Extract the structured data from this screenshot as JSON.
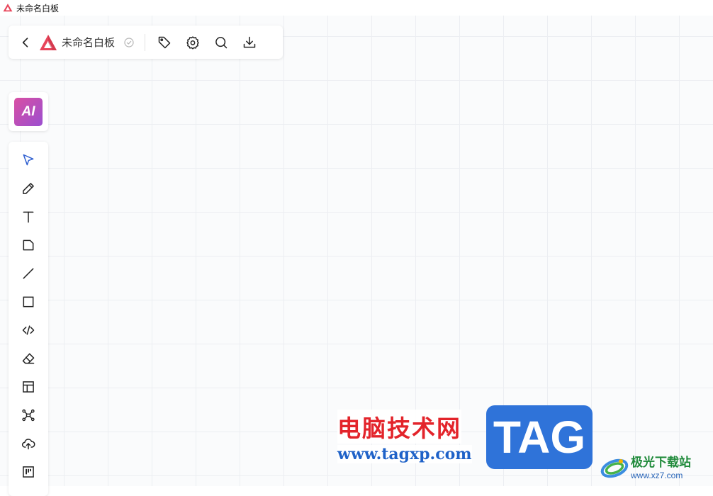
{
  "window": {
    "title": "未命名白板",
    "icons": {
      "app_logo": "red-triangle-logo-icon"
    }
  },
  "topbar": {
    "board_name": "未命名白板",
    "icons": {
      "back": "chevron-left-icon",
      "logo": "red-triangle-logo-icon",
      "saved": "check-circle-icon",
      "tag": "tag-icon",
      "settings": "gear-icon",
      "search": "search-icon",
      "download": "download-icon"
    }
  },
  "ai_button": {
    "label": "AI"
  },
  "toolbar": {
    "tools": [
      {
        "id": "select",
        "icon": "pointer-icon",
        "active": true
      },
      {
        "id": "pen",
        "icon": "pencil-icon"
      },
      {
        "id": "text",
        "icon": "text-icon"
      },
      {
        "id": "note",
        "icon": "sticky-note-icon"
      },
      {
        "id": "line",
        "icon": "line-icon"
      },
      {
        "id": "rectangle",
        "icon": "rectangle-icon"
      },
      {
        "id": "code",
        "icon": "code-icon"
      },
      {
        "id": "eraser",
        "icon": "eraser-icon"
      },
      {
        "id": "template",
        "icon": "layout-icon"
      },
      {
        "id": "mindmap",
        "icon": "mindmap-icon"
      },
      {
        "id": "upload",
        "icon": "cloud-upload-icon"
      },
      {
        "id": "kanban",
        "icon": "kanban-icon"
      }
    ]
  },
  "watermark": {
    "cn_text": "电脑技术网",
    "url": "www.tagxp.com",
    "tag": "TAG",
    "site_name": "极光下载站",
    "site_url": "www.xz7.com"
  },
  "colors": {
    "accent": "#2f5fd0",
    "logo_red": "#e8455a",
    "ai_gradient_start": "#d94fa3",
    "ai_gradient_end": "#9b4fd0",
    "grid": "#eceef2",
    "canvas": "#fafbfc"
  }
}
